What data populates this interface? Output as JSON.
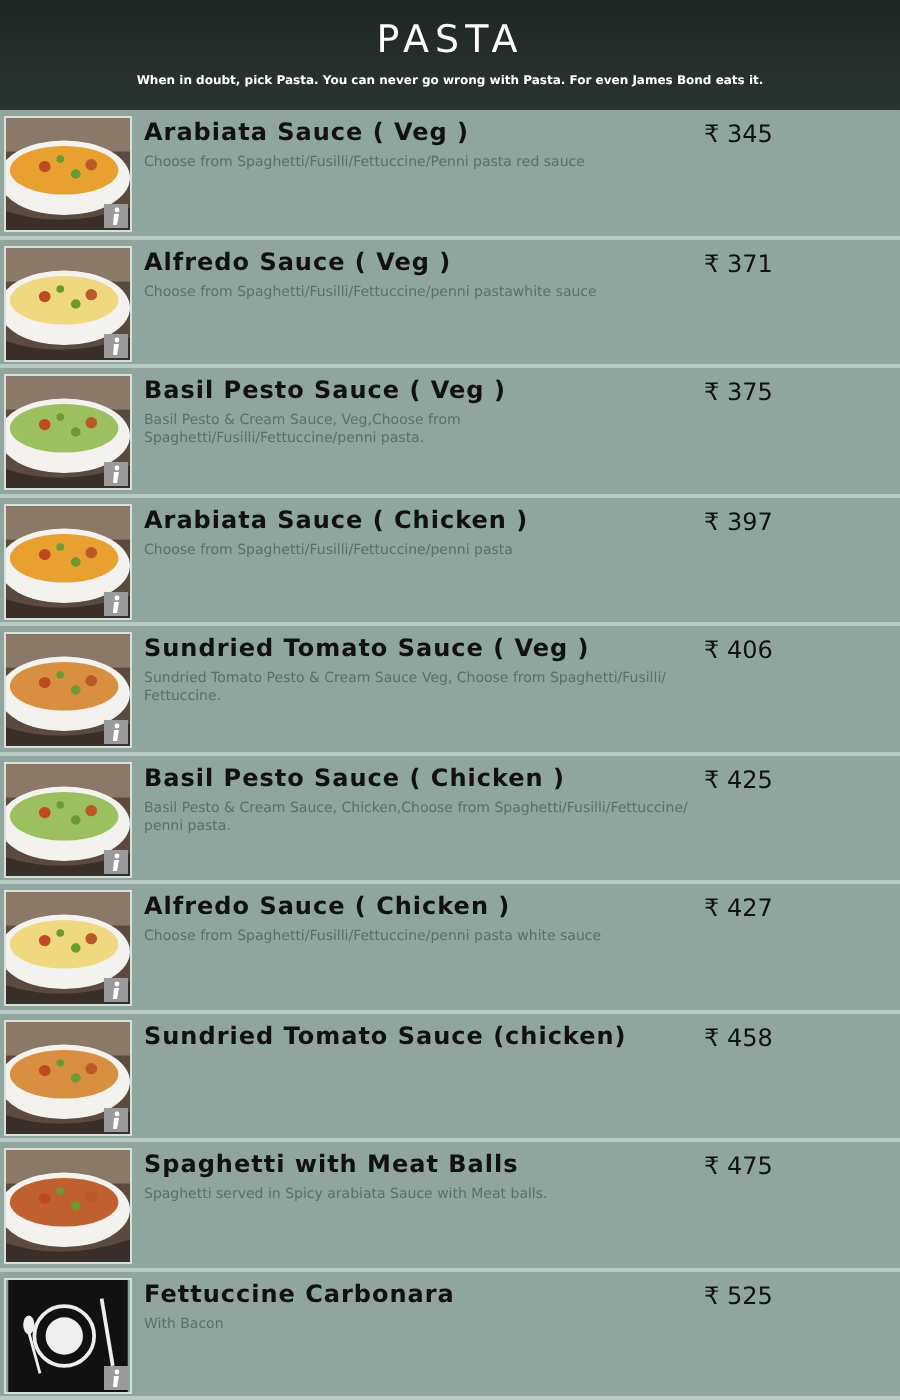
{
  "header": {
    "title": "PASTA",
    "tagline": "When in doubt, pick Pasta. You can never go wrong with Pasta. For even James Bond eats it."
  },
  "items": [
    {
      "name": "Arabiata Sauce ( Veg )",
      "description": "Choose from Spaghetti/Fusilli/Fettuccine/Penni pasta red sauce",
      "price": "₹ 345",
      "kind": "picture",
      "info": true
    },
    {
      "name": "Alfredo Sauce ( Veg )",
      "description": "Choose from Spaghetti/Fusilli/Fettuccine/penni pastawhite sauce",
      "price": "₹ 371",
      "kind": "picture",
      "info": true
    },
    {
      "name": "Basil Pesto Sauce ( Veg )",
      "description": "Basil Pesto & Cream Sauce, Veg,Choose from Spaghetti/Fusilli/Fettuccine/penni pasta.",
      "price": "₹ 375",
      "kind": "picture",
      "info": true
    },
    {
      "name": "Arabiata Sauce ( Chicken )",
      "description": "Choose from Spaghetti/Fusilli/Fettuccine/penni pasta",
      "price": "₹ 397",
      "kind": "picture",
      "info": true
    },
    {
      "name": "Sundried Tomato Sauce ( Veg )",
      "description": "Sundried Tomato Pesto & Cream Sauce Veg, Choose from Spaghetti/Fusilli/ Fettuccine.",
      "price": "₹ 406",
      "kind": "picture",
      "info": true
    },
    {
      "name": "Basil Pesto Sauce ( Chicken )",
      "description": "Basil Pesto & Cream Sauce, Chicken,Choose from Spaghetti/Fusilli/Fettuccine/ penni pasta.",
      "price": "₹ 425",
      "kind": "picture",
      "info": true
    },
    {
      "name": "Alfredo Sauce ( Chicken )",
      "description": "Choose from Spaghetti/Fusilli/Fettuccine/penni pasta white sauce",
      "price": "₹ 427",
      "kind": "picture",
      "info": true
    },
    {
      "name": "Sundried Tomato Sauce (chicken)",
      "price": "₹ 458",
      "kind": "picture",
      "info": true
    },
    {
      "name": "Spaghetti with Meat Balls",
      "description": "Spaghetti served in Spicy arabiata Sauce with Meat balls.",
      "price": "₹ 475",
      "kind": "picture",
      "info": false
    },
    {
      "name": "Fettuccine Carbonara",
      "description": "With Bacon",
      "price": "₹ 525",
      "kind": "placeholder",
      "info": true
    }
  ]
}
